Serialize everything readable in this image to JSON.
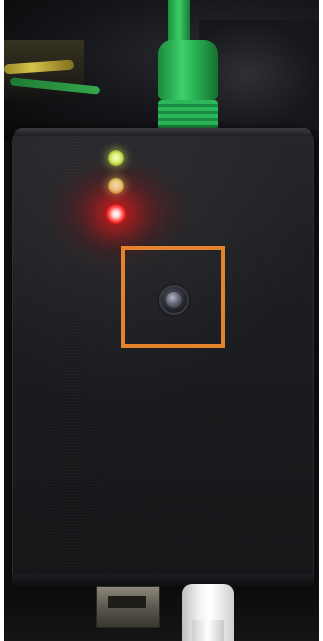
{
  "image": {
    "scene": "network-adapter-device-photo",
    "colors": {
      "highlight_box": "#e5822e",
      "device_body": "#1a1b1e",
      "ethernet_cable": "#2bb556",
      "led_green": "#d8f06a",
      "led_yellow": "#eef08a",
      "led_red": "#ff3a3a"
    },
    "leds": [
      {
        "name": "led-top",
        "color": "green",
        "state": "on"
      },
      {
        "name": "led-middle",
        "color": "yellow-green",
        "state": "on"
      },
      {
        "name": "led-bottom",
        "color": "red",
        "state": "on"
      }
    ]
  }
}
